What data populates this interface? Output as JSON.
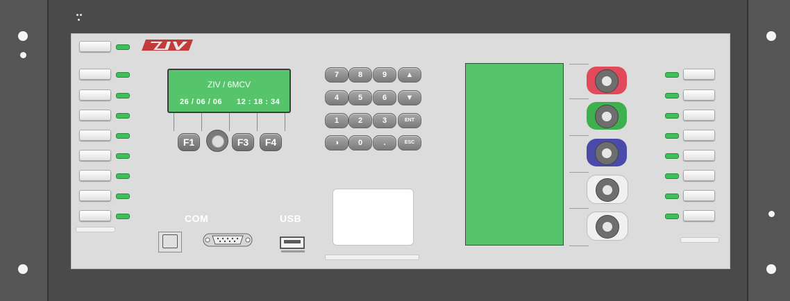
{
  "brand": {
    "logo_text": "ZIV",
    "logo_color": "#c23a3a"
  },
  "lcd": {
    "line1": "ZIV / 6MCV",
    "date": "26 / 06 / 06",
    "time": "12 : 18 : 34",
    "color": "#56c46a"
  },
  "function_keys": [
    "F1",
    "F3",
    "F4"
  ],
  "keypad": {
    "row1": [
      "7",
      "8",
      "9"
    ],
    "row2": [
      "4",
      "5",
      "6"
    ],
    "row3": [
      "1",
      "2",
      "3"
    ],
    "row4": [
      "0",
      "."
    ],
    "ent": "ENT",
    "esc": "ESC",
    "up_icon": "arrow-up-icon",
    "down_icon": "arrow-down-icon",
    "contrast_icon": "contrast-icon"
  },
  "ports": {
    "com_label": "COM",
    "usb_label": "USB"
  },
  "control_buttons": [
    {
      "color": "#e04a5a"
    },
    {
      "color": "#3fb04f"
    },
    {
      "color": "#4a4aa8"
    },
    {
      "color": "#f0f0f0"
    },
    {
      "color": "#f0f0f0"
    }
  ],
  "colors": {
    "led_green": "#3fbf5a",
    "panel": "#dcdcdc",
    "rack": "#4a4a4a"
  }
}
